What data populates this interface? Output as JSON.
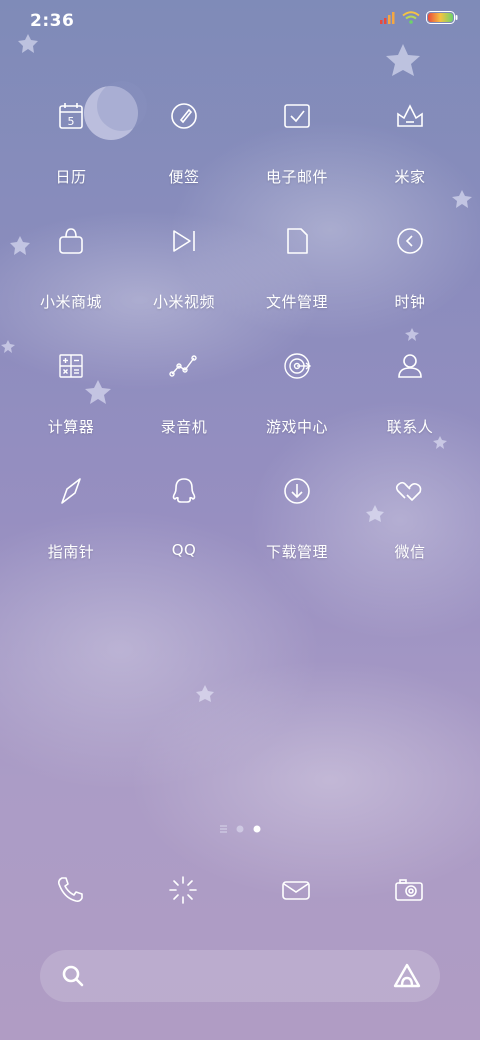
{
  "status_bar": {
    "time": "2:36",
    "icons": [
      "signal-icon",
      "wifi-icon",
      "battery-icon"
    ]
  },
  "apps": [
    [
      {
        "label": "日历",
        "icon": "calendar-icon",
        "day": "5"
      },
      {
        "label": "便签",
        "icon": "notes-icon"
      },
      {
        "label": "电子邮件",
        "icon": "email-icon"
      },
      {
        "label": "米家",
        "icon": "mijia-icon"
      }
    ],
    [
      {
        "label": "小米商城",
        "icon": "shopping-bag-icon"
      },
      {
        "label": "小米视频",
        "icon": "video-icon"
      },
      {
        "label": "文件管理",
        "icon": "file-icon"
      },
      {
        "label": "时钟",
        "icon": "clock-icon"
      }
    ],
    [
      {
        "label": "计算器",
        "icon": "calculator-icon"
      },
      {
        "label": "录音机",
        "icon": "recorder-icon"
      },
      {
        "label": "游戏中心",
        "icon": "game-center-icon"
      },
      {
        "label": "联系人",
        "icon": "contacts-icon"
      }
    ],
    [
      {
        "label": "指南针",
        "icon": "compass-icon"
      },
      {
        "label": "QQ",
        "icon": "qq-icon"
      },
      {
        "label": "下载管理",
        "icon": "download-icon"
      },
      {
        "label": "微信",
        "icon": "wechat-icon"
      }
    ]
  ],
  "page_indicator": {
    "items": [
      "menu-lines",
      "page",
      "page-current"
    ],
    "current": 3,
    "total": 3
  },
  "dock": [
    "phone-icon",
    "settings-sparkle-icon",
    "messages-icon",
    "camera-icon"
  ],
  "search_bar": {
    "icon": "search-icon",
    "assistant_icon": "xiao-ai-icon"
  },
  "colors": {
    "bg_top": "#7f8bb8",
    "bg_bottom": "#b09cc4",
    "foreground": "#ffffff",
    "battery_low": "#e94b3c",
    "battery_mid": "#f5c342",
    "battery_high": "#6dd36a"
  }
}
